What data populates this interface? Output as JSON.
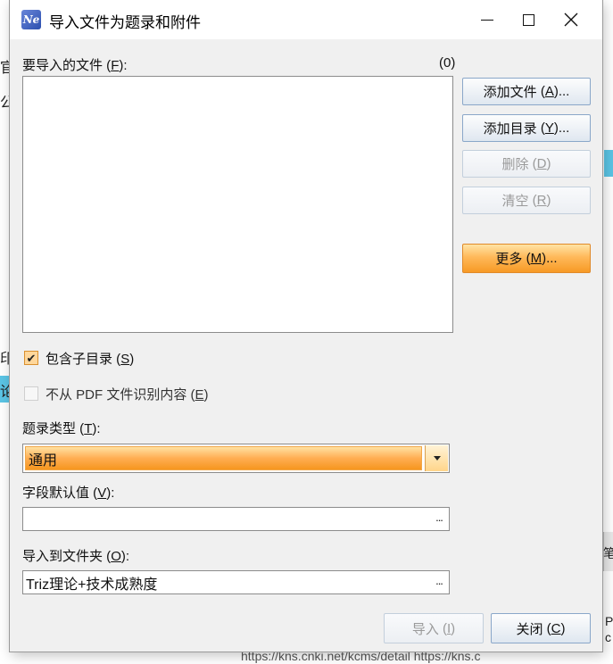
{
  "background": {
    "fragments_left": [
      "官",
      "公",
      "印",
      "论"
    ],
    "fragments_right": [
      "笔",
      "P",
      "c"
    ],
    "status_text": "https://kns.cnki.net/kcms/detail   https://kns.c"
  },
  "window": {
    "title": "导入文件为题录和附件",
    "icon_label": "Ne"
  },
  "files": {
    "label": "要导入的文件",
    "mnemonic": "F",
    "count": "(0)",
    "items": []
  },
  "buttons": {
    "add_file": {
      "label": "添加文件",
      "mnemonic": "A",
      "suffix": "..."
    },
    "add_dir": {
      "label": "添加目录",
      "mnemonic": "Y",
      "suffix": "..."
    },
    "delete": {
      "label": "删除",
      "mnemonic": "D"
    },
    "clear": {
      "label": "清空",
      "mnemonic": "R"
    },
    "more": {
      "label": "更多",
      "mnemonic": "M",
      "suffix": "..."
    },
    "import": {
      "label": "导入",
      "mnemonic": "I"
    },
    "close": {
      "label": "关闭",
      "mnemonic": "C"
    }
  },
  "options": {
    "include_subdirs": {
      "label": "包含子目录",
      "mnemonic": "S",
      "checked": true
    },
    "no_pdf_ocr": {
      "label": "不从 PDF 文件识别内容",
      "mnemonic": "E",
      "checked": false
    }
  },
  "record_type": {
    "label": "题录类型",
    "mnemonic": "T",
    "value": "通用"
  },
  "field_default": {
    "label": "字段默认值",
    "mnemonic": "V",
    "value": "",
    "browse": "..."
  },
  "import_folder": {
    "label": "导入到文件夹",
    "mnemonic": "O",
    "value": "Triz理论+技术成熟度",
    "browse": "..."
  },
  "colors": {
    "accent_orange": "#f79a25",
    "button_border": "#8aa7c9",
    "dialog_bg": "#f0f0f0"
  }
}
